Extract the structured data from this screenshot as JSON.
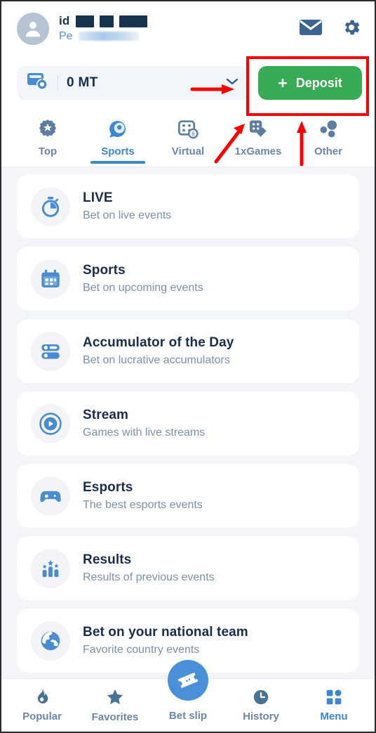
{
  "header": {
    "avatar_name": "user-avatar",
    "id_label": "id",
    "profile_prefix": "Pe",
    "profile_suffix": "profile",
    "mail_icon": "envelope-icon",
    "settings_icon": "gear-icon"
  },
  "balance": {
    "wallet_icon": "wallet-refresh-icon",
    "amount": "0 MT",
    "chevron": "chevron-down-icon",
    "deposit_label": "Deposit",
    "deposit_plus": "+"
  },
  "tabs": [
    {
      "label": "Top",
      "icon": "badge-star-icon",
      "active": false
    },
    {
      "label": "Sports",
      "icon": "soccer-ball-icon",
      "active": true
    },
    {
      "label": "Virtual",
      "icon": "virtual-dice-screen-icon",
      "active": false
    },
    {
      "label": "1xGames",
      "icon": "dice-icon",
      "active": false
    },
    {
      "label": "Other",
      "icon": "three-dots-icon",
      "active": false
    }
  ],
  "list": [
    {
      "title": "LIVE",
      "subtitle": "Bet on live events",
      "icon": "stopwatch-icon"
    },
    {
      "title": "Sports",
      "subtitle": "Bet on upcoming events",
      "icon": "calendar-icon"
    },
    {
      "title": "Accumulator of the Day",
      "subtitle": "Bet on lucrative accumulators",
      "icon": "accumulator-list-icon"
    },
    {
      "title": "Stream",
      "subtitle": "Games with live streams",
      "icon": "play-circle-icon"
    },
    {
      "title": "Esports",
      "subtitle": "The best esports events",
      "icon": "gamepad-icon"
    },
    {
      "title": "Results",
      "subtitle": "Results of previous events",
      "icon": "results-bars-icon"
    },
    {
      "title": "Bet on your national team",
      "subtitle": "Favorite country events",
      "icon": "globe-icon"
    }
  ],
  "bottom_nav": [
    {
      "label": "Popular",
      "icon": "flame-icon",
      "active": false
    },
    {
      "label": "Favorites",
      "icon": "star-icon",
      "active": false
    },
    {
      "label": "Bet slip",
      "icon": "ticket-icon",
      "active": false
    },
    {
      "label": "History",
      "icon": "clock-icon",
      "active": false
    },
    {
      "label": "Menu",
      "icon": "grid-icon",
      "active": true
    }
  ],
  "colors": {
    "accent_blue": "#3d86d0",
    "deposit_green": "#39ab55",
    "annotation_red": "#ff0000",
    "title_navy": "#1b2d4d",
    "subtitle_slate": "#7d90ad",
    "page_bg": "#f3f5f9"
  }
}
